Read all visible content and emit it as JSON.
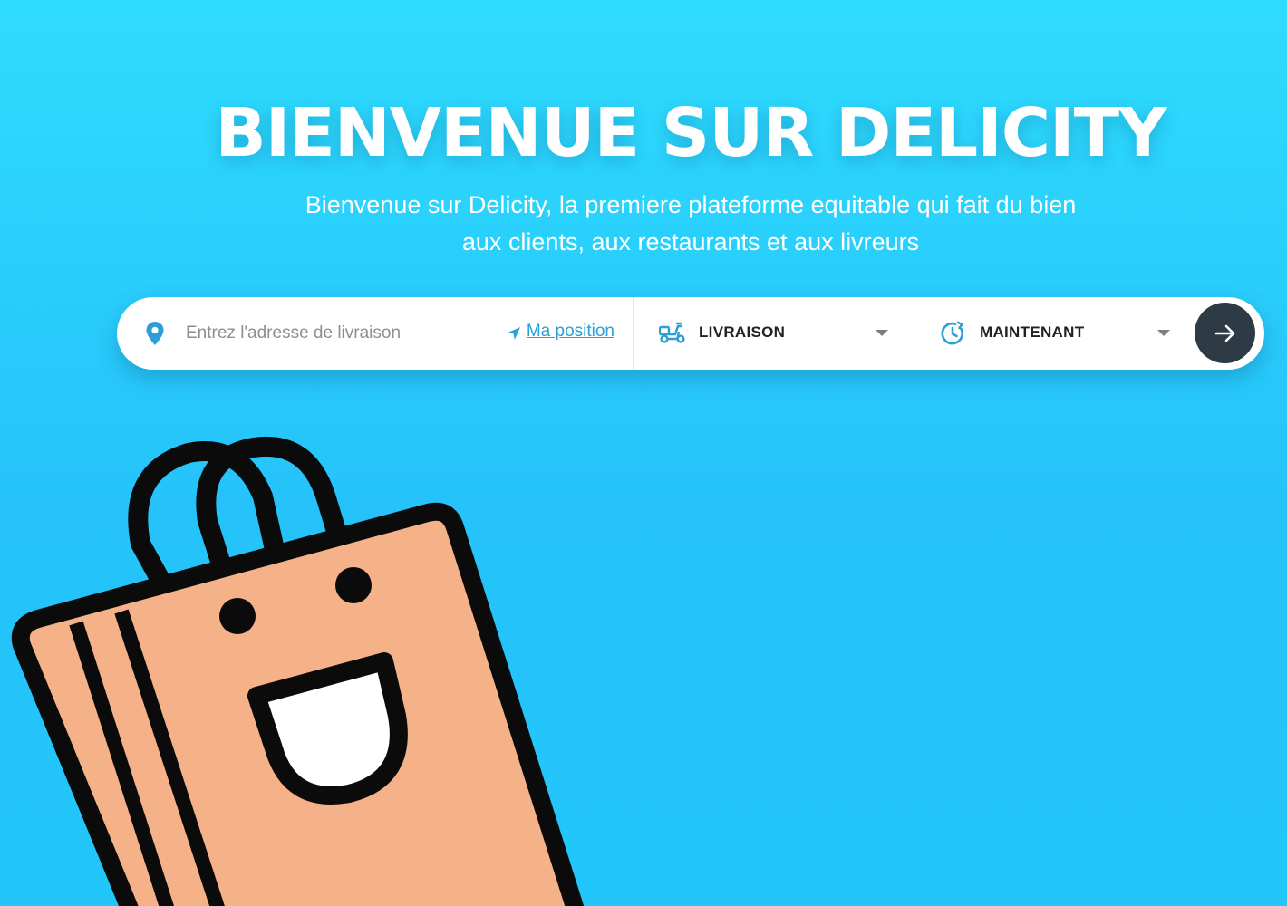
{
  "hero": {
    "title": "BIENVENUE SUR DELICITY",
    "subtitle": "Bienvenue sur Delicity, la premiere plateforme equitable qui fait du bien aux clients, aux restaurants et aux livreurs"
  },
  "search": {
    "address_placeholder": "Entrez l'adresse de livraison",
    "address_value": "",
    "my_position_label": "Ma position",
    "mode_selected": "LIVRAISON",
    "time_selected": "MAINTENANT"
  },
  "icons": {
    "address": "map-pin-icon",
    "my_position": "navigation-arrow-icon",
    "mode": "scooter-icon",
    "time": "clock-icon",
    "dropdown": "chevron-down-icon",
    "submit": "arrow-right-icon"
  },
  "colors": {
    "background": "#25c8fb",
    "accent": "#2b9fd6",
    "submit_button": "#2f3b44",
    "bag_fill": "#f5b289",
    "bag_outline": "#0b0b0b"
  }
}
